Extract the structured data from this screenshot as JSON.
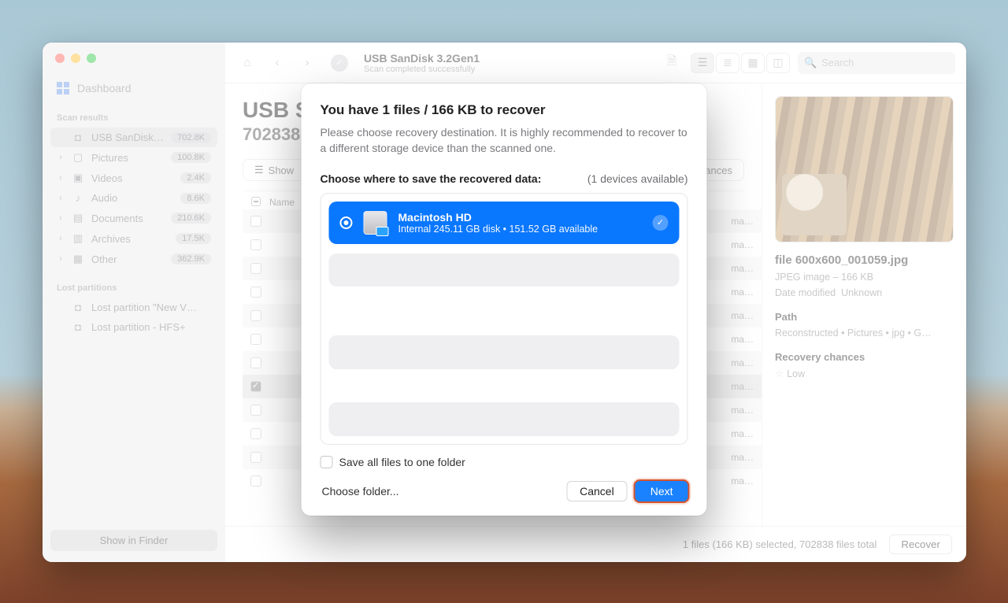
{
  "window": {
    "toolbar": {
      "title": "USB  SanDisk 3.2Gen1",
      "subtitle": "Scan completed successfully",
      "search_placeholder": "Search"
    },
    "header": {
      "title_truncated": "USB  S",
      "subtitle_truncated": "702838"
    },
    "filterbar": {
      "show_label": "Show",
      "chances_label": "chances"
    },
    "table": {
      "col_name": "Name",
      "rows": [
        {
          "checked": false,
          "right": "ma…"
        },
        {
          "checked": false,
          "right": "ma…"
        },
        {
          "checked": false,
          "right": "ma…"
        },
        {
          "checked": false,
          "right": "ma…"
        },
        {
          "checked": false,
          "right": "ma…"
        },
        {
          "checked": false,
          "right": "ma…"
        },
        {
          "checked": false,
          "right": "ma…"
        },
        {
          "checked": true,
          "right": "ma…",
          "selected": true
        },
        {
          "checked": false,
          "right": "ma…"
        },
        {
          "checked": false,
          "right": "ma…"
        },
        {
          "checked": false,
          "right": "ma…"
        },
        {
          "checked": false,
          "right": "ma…"
        },
        {
          "checked": false,
          "right": "ma…"
        }
      ]
    },
    "statusbar": {
      "summary": "1 files (166 KB) selected, 702838 files total",
      "recover_label": "Recover"
    }
  },
  "sidebar": {
    "dashboard_label": "Dashboard",
    "scan_results_label": "Scan results",
    "show_finder_label": "Show in Finder",
    "lost_partitions_label": "Lost partitions",
    "results": {
      "device": {
        "label": "USB  SanDisk…",
        "badge": "702.8K"
      },
      "categories": [
        {
          "label": "Pictures",
          "badge": "100.8K"
        },
        {
          "label": "Videos",
          "badge": "2.4K"
        },
        {
          "label": "Audio",
          "badge": "8.6K"
        },
        {
          "label": "Documents",
          "badge": "210.6K"
        },
        {
          "label": "Archives",
          "badge": "17.5K"
        },
        {
          "label": "Other",
          "badge": "362.9K"
        }
      ]
    },
    "lost": [
      {
        "label": "Lost partition \"New V…"
      },
      {
        "label": "Lost partition - HFS+"
      }
    ]
  },
  "preview": {
    "filename": "file 600x600_001059.jpg",
    "kind": "JPEG image – 166 KB",
    "date_modified_label": "Date modified",
    "date_modified_value": "Unknown",
    "path_label": "Path",
    "path_value": "Reconstructed • Pictures • jpg • G…",
    "chances_label": "Recovery chances",
    "chances_value": "Low"
  },
  "modal": {
    "title": "You have 1 files / 166 KB to recover",
    "subtitle": "Please choose recovery destination. It is highly recommended to recover to a different storage device than the scanned one.",
    "choose_label": "Choose where to save the recovered data:",
    "devices_available": "(1 devices available)",
    "destination": {
      "name": "Macintosh HD",
      "details": "Internal 245.11 GB disk • 151.52 GB available"
    },
    "save_all_label": "Save all files to one folder",
    "choose_folder_label": "Choose folder...",
    "cancel_label": "Cancel",
    "next_label": "Next"
  },
  "colors": {
    "accent": "#1a82ff",
    "highlight": "#d6532c"
  }
}
